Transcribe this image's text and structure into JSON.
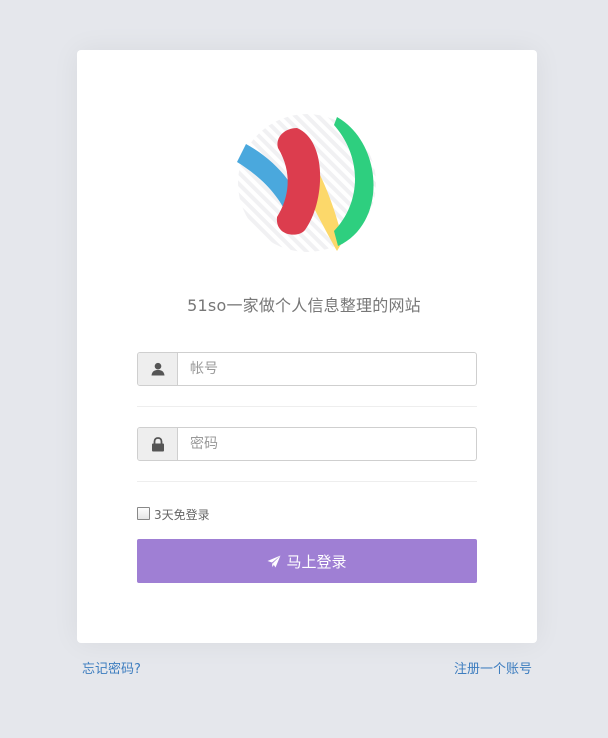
{
  "brand": {
    "tagline": "51so一家做个人信息整理的网站",
    "logo_colors": [
      "#4aa8dd",
      "#dc3d4e",
      "#fcd86a",
      "#2ecf7f"
    ]
  },
  "form": {
    "account": {
      "placeholder": "帐号",
      "value": "",
      "icon": "user-icon"
    },
    "password": {
      "placeholder": "密码",
      "value": "",
      "icon": "lock-icon"
    },
    "remember_label": "3天免登录",
    "remember_checked": false,
    "submit_label": "马上登录",
    "submit_icon": "paper-plane-icon"
  },
  "links": {
    "forgot_password": "忘记密码?",
    "register": "注册一个账号"
  },
  "colors": {
    "page_bg": "#e5e7ec",
    "card_bg": "#ffffff",
    "button_bg": "#9f7fd4",
    "link": "#3d7dbf"
  }
}
